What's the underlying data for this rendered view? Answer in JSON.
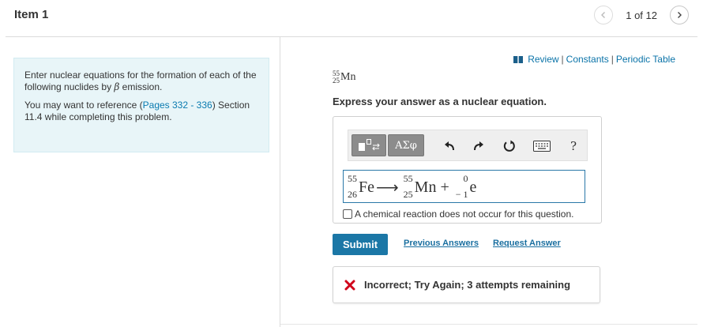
{
  "header": {
    "item_title": "Item 1",
    "pager": {
      "current": "1",
      "sep": "of",
      "total": "12",
      "label": "1 of 12"
    }
  },
  "intro": {
    "line1_prefix": "Enter nuclear equations for the formation of each of the following nuclides by ",
    "beta_symbol": "β",
    "line1_suffix": " emission.",
    "line2_prefix": "You may want to reference (",
    "link_text": "Pages 332 - 336",
    "line2_suffix": ") Section 11.4 while completing this problem."
  },
  "resources": {
    "icon": "book-icon",
    "review": "Review",
    "separator": "|",
    "constants": "Constants",
    "periodic_table": "Periodic Table"
  },
  "nuclide": {
    "mass": "55",
    "atomic": "25",
    "symbol": "Mn"
  },
  "prompt": "Express your answer as a nuclear equation.",
  "toolbar": {
    "templates_icon": "templates-icon",
    "greek_label": "ΑΣφ",
    "undo_icon": "undo-icon",
    "redo_icon": "redo-icon",
    "reset_icon": "reset-icon",
    "keyboard_icon": "keyboard-icon",
    "help_label": "?"
  },
  "equation": {
    "reactant": {
      "mass": "55",
      "atomic": "26",
      "symbol": "Fe"
    },
    "arrow": "⟶",
    "product1": {
      "mass": "55",
      "atomic": "25",
      "symbol": "Mn"
    },
    "plus": "+",
    "product2": {
      "mass": "0",
      "atomic": "− 1",
      "symbol": "e"
    }
  },
  "no_reaction_checkbox": {
    "label": "A chemical reaction does not occur for this question.",
    "checked": false
  },
  "actions": {
    "submit": "Submit",
    "previous_answers": "Previous Answers",
    "request_answer": "Request Answer"
  },
  "feedback": {
    "icon": "x-icon",
    "text": "Incorrect; Try Again; 3 attempts remaining",
    "icon_color": "#d0021b"
  },
  "colors": {
    "accent": "#1b77a6",
    "link": "#0a73a8",
    "intro_bg": "#e8f5f8",
    "error": "#d0021b"
  }
}
